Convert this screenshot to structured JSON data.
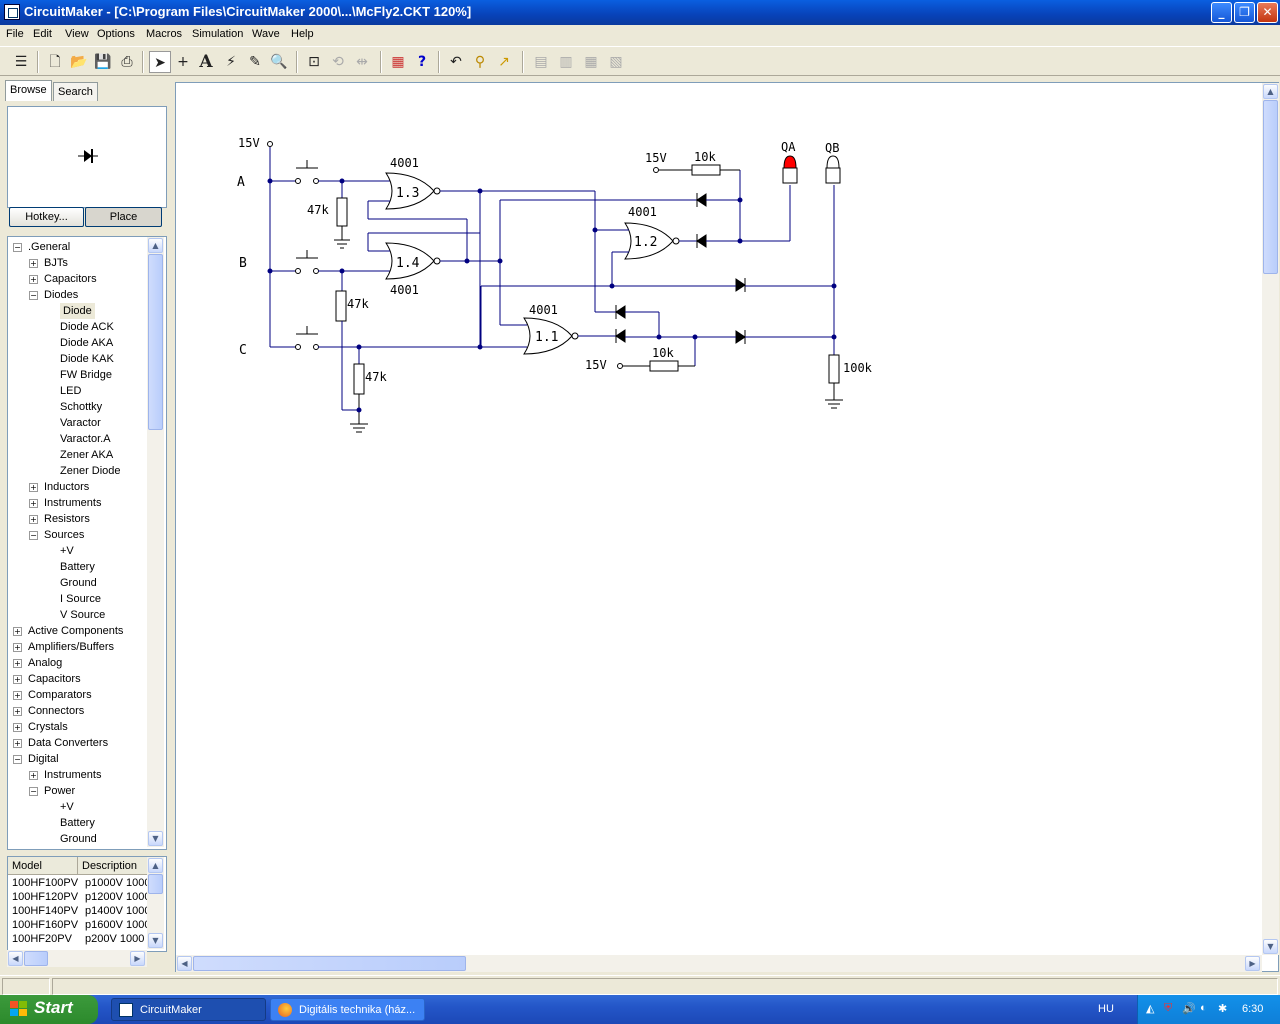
{
  "window": {
    "title": "CircuitMaker - [C:\\Program Files\\CircuitMaker 2000\\...\\McFly2.CKT 120%]"
  },
  "menu": [
    "File",
    "Edit",
    "View",
    "Options",
    "Macros",
    "Simulation",
    "Wave",
    "Help"
  ],
  "toolbar": {
    "icons": [
      "browse-toggle-icon",
      "new-icon",
      "open-icon",
      "save-icon",
      "print-icon",
      "arrow-icon",
      "wire-icon",
      "text-icon",
      "probe-icon",
      "probe2-icon",
      "zoom-icon",
      "fit-icon",
      "rotate-icon",
      "mirror-icon",
      "netlist-icon",
      "help-icon",
      "undo-icon",
      "tool-icon",
      "trace-icon",
      "align1-icon",
      "align2-icon",
      "align3-icon",
      "align4-icon"
    ]
  },
  "left_panel": {
    "tabs": [
      "Browse",
      "Search"
    ],
    "active_tab": "Browse",
    "hotkey_button": "Hotkey...",
    "place_button": "Place",
    "tree": [
      {
        "label": ".General",
        "level": 0,
        "state": "-"
      },
      {
        "label": "BJTs",
        "level": 1,
        "state": "+"
      },
      {
        "label": "Capacitors",
        "level": 1,
        "state": "+"
      },
      {
        "label": "Diodes",
        "level": 1,
        "state": "-"
      },
      {
        "label": "Diode",
        "level": 2,
        "state": "",
        "selected": true
      },
      {
        "label": "Diode ACK",
        "level": 2,
        "state": ""
      },
      {
        "label": "Diode AKA",
        "level": 2,
        "state": ""
      },
      {
        "label": "Diode KAK",
        "level": 2,
        "state": ""
      },
      {
        "label": "FW Bridge",
        "level": 2,
        "state": ""
      },
      {
        "label": "LED",
        "level": 2,
        "state": ""
      },
      {
        "label": "Schottky",
        "level": 2,
        "state": ""
      },
      {
        "label": "Varactor",
        "level": 2,
        "state": ""
      },
      {
        "label": "Varactor.A",
        "level": 2,
        "state": ""
      },
      {
        "label": "Zener AKA",
        "level": 2,
        "state": ""
      },
      {
        "label": "Zener Diode",
        "level": 2,
        "state": ""
      },
      {
        "label": "Inductors",
        "level": 1,
        "state": "+"
      },
      {
        "label": "Instruments",
        "level": 1,
        "state": "+"
      },
      {
        "label": "Resistors",
        "level": 1,
        "state": "+"
      },
      {
        "label": "Sources",
        "level": 1,
        "state": "-"
      },
      {
        "label": "+V",
        "level": 2,
        "state": ""
      },
      {
        "label": "Battery",
        "level": 2,
        "state": ""
      },
      {
        "label": "Ground",
        "level": 2,
        "state": ""
      },
      {
        "label": "I Source",
        "level": 2,
        "state": ""
      },
      {
        "label": "V Source",
        "level": 2,
        "state": ""
      },
      {
        "label": "Active Components",
        "level": 0,
        "state": "+"
      },
      {
        "label": "Amplifiers/Buffers",
        "level": 0,
        "state": "+"
      },
      {
        "label": "Analog",
        "level": 0,
        "state": "+"
      },
      {
        "label": "Capacitors",
        "level": 0,
        "state": "+"
      },
      {
        "label": "Comparators",
        "level": 0,
        "state": "+"
      },
      {
        "label": "Connectors",
        "level": 0,
        "state": "+"
      },
      {
        "label": "Crystals",
        "level": 0,
        "state": "+"
      },
      {
        "label": "Data Converters",
        "level": 0,
        "state": "+"
      },
      {
        "label": "Digital",
        "level": 0,
        "state": "-"
      },
      {
        "label": "Instruments",
        "level": 1,
        "state": "+"
      },
      {
        "label": "Power",
        "level": 1,
        "state": "-"
      },
      {
        "label": "+V",
        "level": 2,
        "state": ""
      },
      {
        "label": "Battery",
        "level": 2,
        "state": ""
      },
      {
        "label": "Ground",
        "level": 2,
        "state": ""
      }
    ],
    "model_headers": [
      "Model",
      "Description"
    ],
    "models": [
      [
        "100HF100PV",
        "p1000V 1000"
      ],
      [
        "100HF120PV",
        "p1200V 1000"
      ],
      [
        "100HF140PV",
        "p1400V 1000"
      ],
      [
        "100HF160PV",
        "p1600V 1000"
      ],
      [
        "100HF20PV",
        "p200V 1000"
      ]
    ]
  },
  "schematic": {
    "source_labels": [
      "15V",
      "15V",
      "15V"
    ],
    "inputs": [
      "A",
      "B",
      "C"
    ],
    "resistors": [
      "47k",
      "47k",
      "47k",
      "10k",
      "10k",
      "100k"
    ],
    "gate_parts": [
      "4001",
      "4001",
      "4001",
      "4001"
    ],
    "gate_ids": [
      "1.3",
      "1.4",
      "1.2",
      "1.1"
    ],
    "outputs": [
      "QA",
      "QB"
    ],
    "colors": {
      "wire": "#000080",
      "led_on": "#ff0000",
      "led_off": "#ffffff"
    }
  },
  "taskbar": {
    "start": "Start",
    "tasks": [
      "CircuitMaker",
      "Digitális technika (ház..."
    ],
    "language": "HU",
    "clock": "6:30"
  }
}
